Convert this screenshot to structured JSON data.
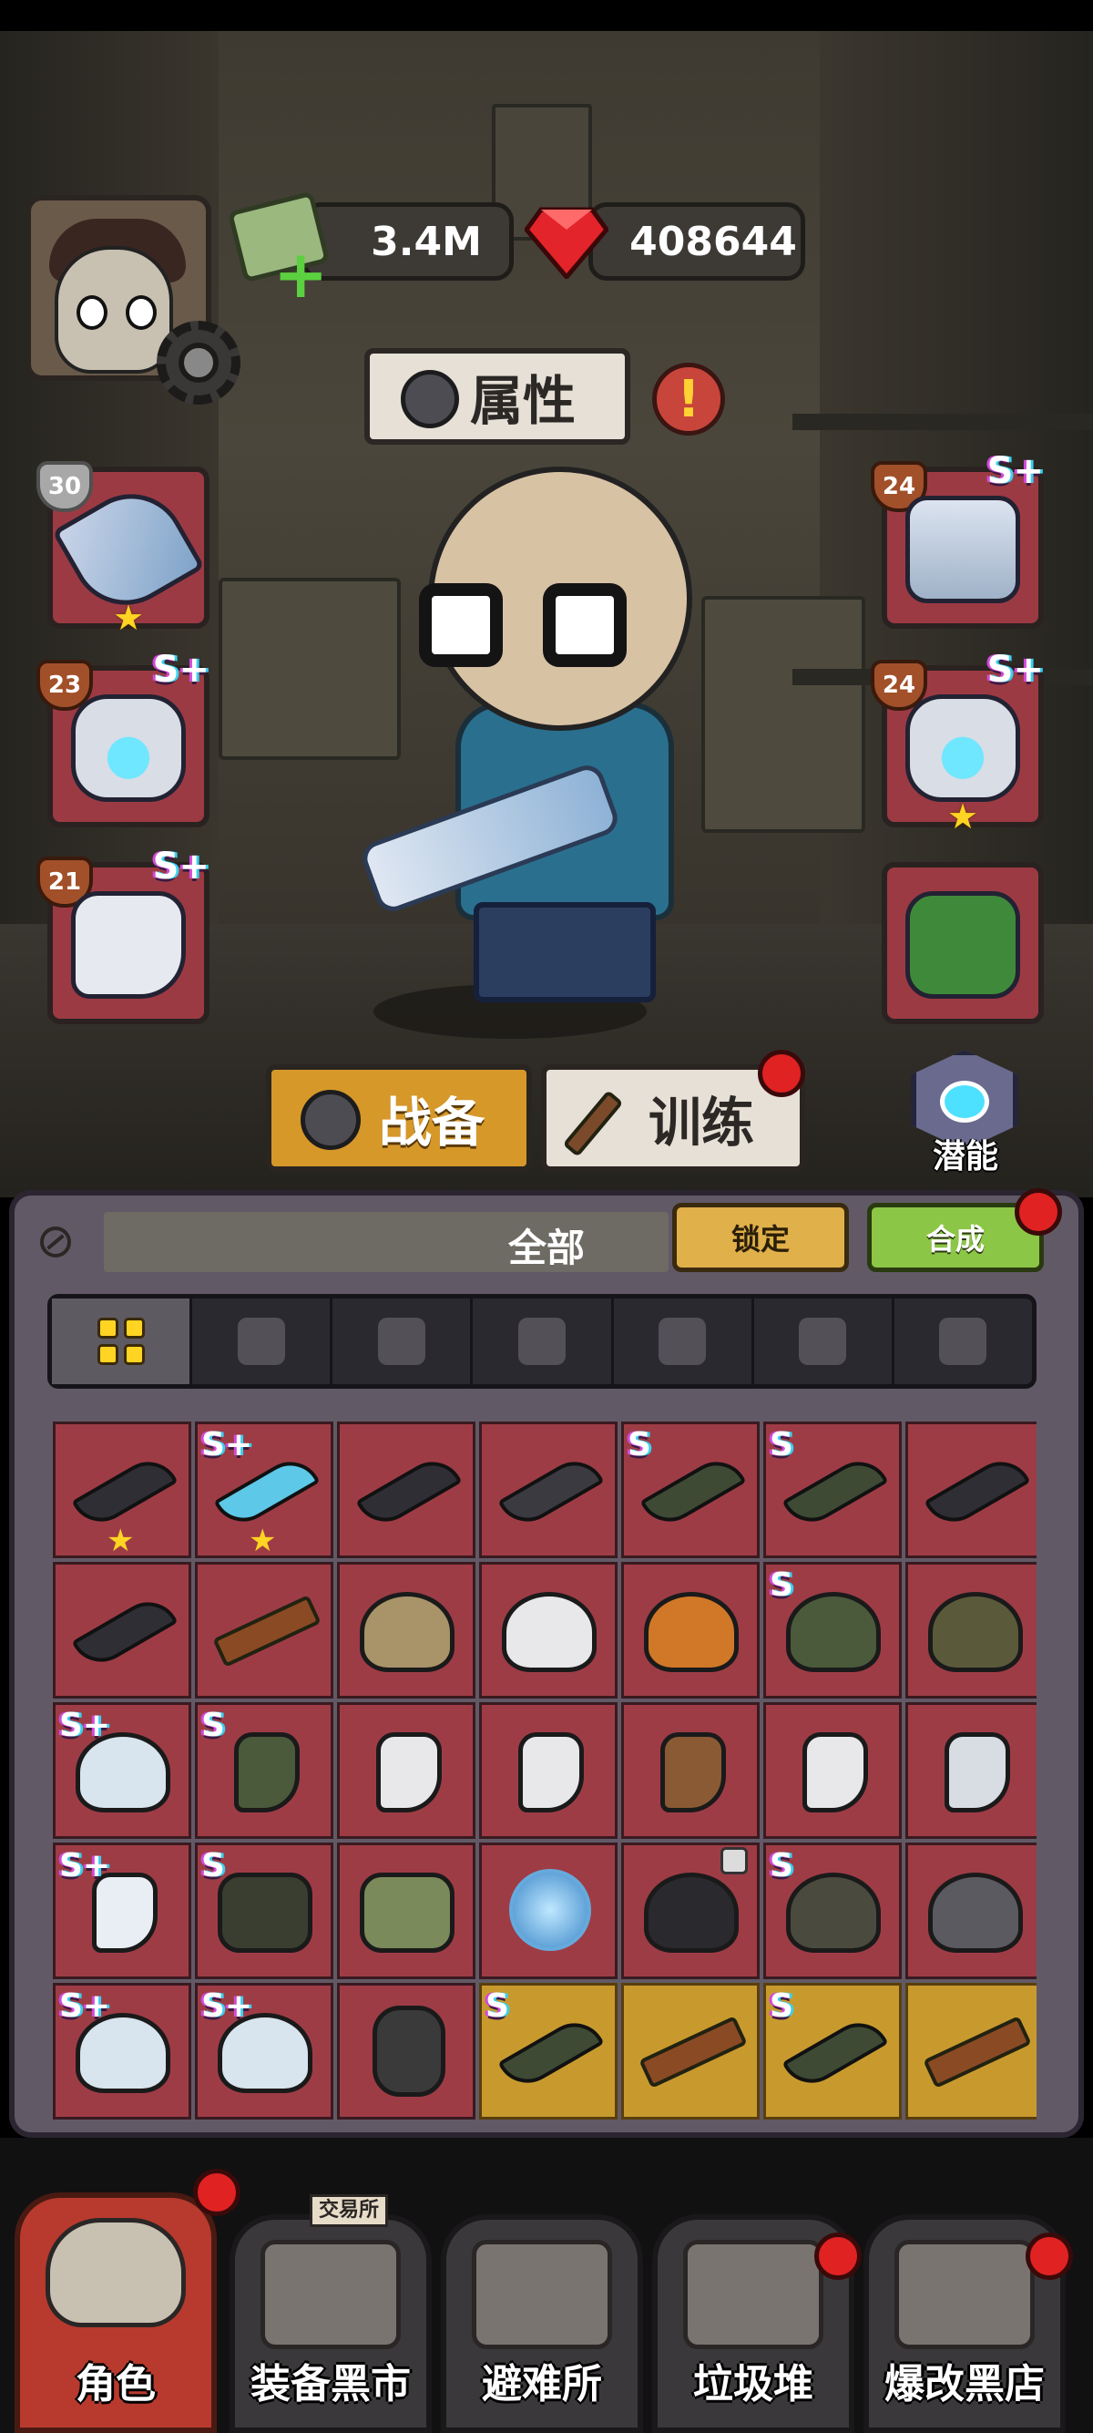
{
  "topbar": {
    "cash": "3.4M",
    "gems": "408644"
  },
  "character": {
    "attributes_label": "属性"
  },
  "equipment": {
    "left": [
      {
        "level": "30",
        "grade": "",
        "starred": true,
        "type": "weapon"
      },
      {
        "level": "23",
        "grade": "S+",
        "starred": false,
        "type": "helmet"
      },
      {
        "level": "21",
        "grade": "S+",
        "starred": false,
        "type": "boot"
      }
    ],
    "right": [
      {
        "level": "24",
        "grade": "S+",
        "starred": false,
        "type": "armor"
      },
      {
        "level": "24",
        "grade": "S+",
        "starred": true,
        "type": "helmet"
      },
      {
        "level": "",
        "grade": "",
        "starred": false,
        "type": "backpack"
      }
    ]
  },
  "tabs": {
    "combat_label": "战备",
    "training_label": "训练",
    "potential_label": "潜能"
  },
  "inventory": {
    "filter_label": "全部",
    "lock_label": "锁定",
    "merge_label": "合成",
    "categories": [
      "all-icon",
      "gun-icon",
      "helmet-icon",
      "pants-icon",
      "armor-icon",
      "mask-icon",
      "backpack-icon"
    ],
    "items": [
      {
        "grade": "",
        "star": true,
        "type": "gun",
        "color": "#2e2e34"
      },
      {
        "grade": "S+",
        "star": true,
        "type": "gun",
        "color": "#5ec8e8"
      },
      {
        "grade": "",
        "star": false,
        "type": "gun",
        "color": "#2e2e34"
      },
      {
        "grade": "",
        "star": false,
        "type": "gun",
        "color": "#3a3a40"
      },
      {
        "grade": "S",
        "star": false,
        "type": "gun",
        "color": "#3e4a34"
      },
      {
        "grade": "S",
        "star": false,
        "type": "gun",
        "color": "#3e4a34"
      },
      {
        "grade": "",
        "star": false,
        "type": "gun",
        "color": "#2e2e34"
      },
      {
        "grade": "",
        "star": false,
        "type": "gun",
        "color": "#2e2e34"
      },
      {
        "grade": "",
        "star": false,
        "type": "ak",
        "color": "#8a4a24"
      },
      {
        "grade": "",
        "star": false,
        "type": "helmet",
        "color": "#a89468"
      },
      {
        "grade": "",
        "star": false,
        "type": "helmet",
        "color": "#e8e8ea"
      },
      {
        "grade": "",
        "star": false,
        "type": "helmet",
        "color": "#d07828"
      },
      {
        "grade": "S",
        "star": false,
        "type": "helmet",
        "color": "#4a5a3a"
      },
      {
        "grade": "",
        "star": false,
        "type": "helmet",
        "color": "#5a5a3a"
      },
      {
        "grade": "S+",
        "star": false,
        "type": "helmet",
        "color": "#d8e4ee"
      },
      {
        "grade": "S",
        "star": false,
        "type": "boot",
        "color": "#4a5a3a"
      },
      {
        "grade": "",
        "star": false,
        "type": "boot",
        "color": "#e8e8ea"
      },
      {
        "grade": "",
        "star": false,
        "type": "boot",
        "color": "#e8e8ea"
      },
      {
        "grade": "",
        "star": false,
        "type": "boot",
        "color": "#8a5a34"
      },
      {
        "grade": "",
        "star": false,
        "type": "boot",
        "color": "#e8e8ea"
      },
      {
        "grade": "",
        "star": false,
        "type": "boot",
        "color": "#d8dde4"
      },
      {
        "grade": "S+",
        "star": false,
        "type": "boot",
        "color": "#e8eef4"
      },
      {
        "grade": "S",
        "star": false,
        "type": "vest",
        "color": "#3a3e30"
      },
      {
        "grade": "",
        "star": false,
        "type": "vest",
        "color": "#7a8a5a"
      },
      {
        "grade": "",
        "star": false,
        "type": "orb",
        "color": "#5aa8e0"
      },
      {
        "grade": "",
        "star": false,
        "type": "helmet",
        "color": "#2a2a2e",
        "locked": true
      },
      {
        "grade": "S",
        "star": false,
        "type": "helmet",
        "color": "#4a4a3e"
      },
      {
        "grade": "",
        "star": false,
        "type": "helmet",
        "color": "#5a5a60"
      },
      {
        "grade": "S+",
        "star": false,
        "type": "helmet",
        "color": "#d8e4ee"
      },
      {
        "grade": "S+",
        "star": false,
        "type": "helmet",
        "color": "#d8e4ee"
      },
      {
        "grade": "",
        "star": false,
        "type": "pack",
        "color": "#3a3a3a"
      },
      {
        "grade": "S",
        "star": false,
        "type": "gun",
        "color": "#3e4a34",
        "gold": true
      },
      {
        "grade": "",
        "star": false,
        "type": "ak",
        "color": "#8a4a24",
        "gold": true
      },
      {
        "grade": "S",
        "star": false,
        "type": "gun",
        "color": "#3e4a34",
        "gold": true
      },
      {
        "grade": "",
        "star": false,
        "type": "ak",
        "color": "#8a4a24",
        "gold": true
      }
    ]
  },
  "nav": {
    "items": [
      {
        "label": "角色",
        "active": true,
        "dot": true
      },
      {
        "label": "装备黑市",
        "active": false,
        "dot": false,
        "sign": "交易所"
      },
      {
        "label": "避难所",
        "active": false,
        "dot": false
      },
      {
        "label": "垃圾堆",
        "active": false,
        "dot": true
      },
      {
        "label": "爆改黑店",
        "active": false,
        "dot": true
      }
    ]
  }
}
